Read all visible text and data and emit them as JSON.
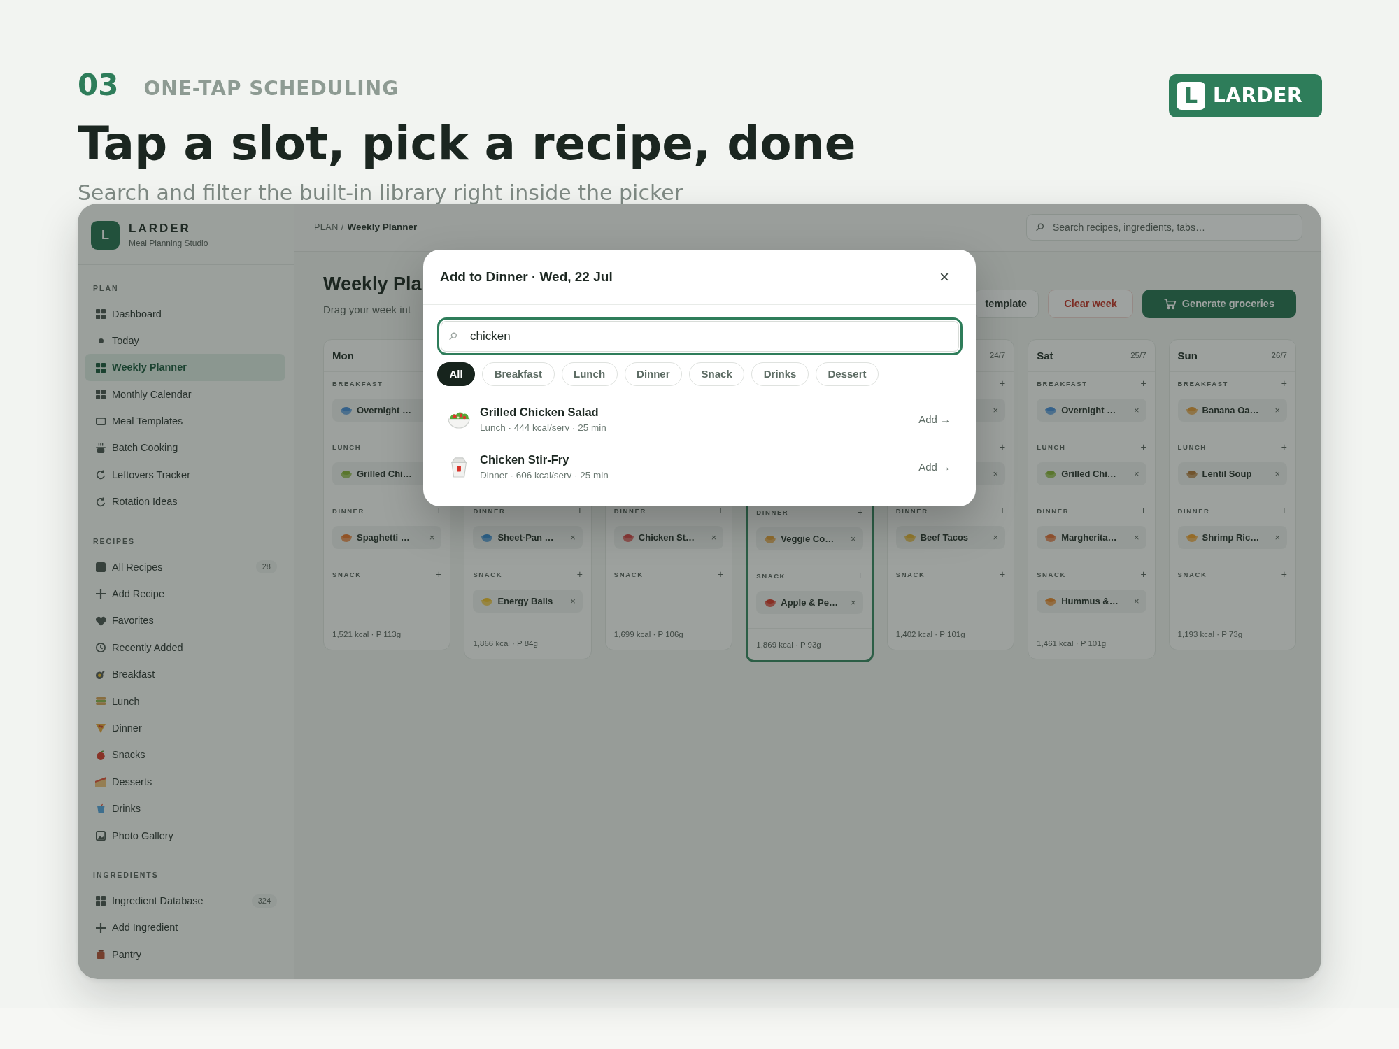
{
  "slide": {
    "number": "03",
    "kicker": "ONE-TAP SCHEDULING",
    "title": "Tap a slot, pick a recipe, done",
    "subtitle": "Search and filter the built-in library right inside the picker",
    "logo": {
      "mark": "L",
      "name": "LARDER"
    }
  },
  "app": {
    "sidebar": {
      "brand": {
        "mark": "L",
        "name": "LARDER",
        "tagline": "Meal Planning Studio"
      },
      "sections": [
        {
          "label": "PLAN",
          "items": [
            {
              "label": "Dashboard",
              "selected": false
            },
            {
              "label": "Today",
              "selected": false
            },
            {
              "label": "Weekly Planner",
              "selected": true
            },
            {
              "label": "Monthly Calendar",
              "selected": false
            },
            {
              "label": "Meal Templates",
              "selected": false
            },
            {
              "label": "Batch Cooking",
              "selected": false
            },
            {
              "label": "Leftovers Tracker",
              "selected": false
            },
            {
              "label": "Rotation Ideas",
              "selected": false
            }
          ]
        },
        {
          "label": "RECIPES",
          "items": [
            {
              "label": "All Recipes",
              "selected": false,
              "count": "28"
            },
            {
              "label": "Add Recipe",
              "selected": false
            },
            {
              "label": "Favorites",
              "selected": false
            },
            {
              "label": "Recently Added",
              "selected": false
            },
            {
              "label": "Breakfast",
              "selected": false
            },
            {
              "label": "Lunch",
              "selected": false
            },
            {
              "label": "Dinner",
              "selected": false
            },
            {
              "label": "Snacks",
              "selected": false
            },
            {
              "label": "Desserts",
              "selected": false
            },
            {
              "label": "Drinks",
              "selected": false
            },
            {
              "label": "Photo Gallery",
              "selected": false
            }
          ]
        },
        {
          "label": "INGREDIENTS",
          "items": [
            {
              "label": "Ingredient Database",
              "selected": false,
              "count": "324"
            },
            {
              "label": "Add Ingredient",
              "selected": false
            },
            {
              "label": "Pantry",
              "selected": false
            }
          ]
        }
      ]
    },
    "topbar": {
      "breadcrumb": {
        "section": "PLAN /",
        "current": "Weekly Planner"
      },
      "search": {
        "placeholder": "Search recipes, ingredients, tabs…"
      }
    },
    "header": {
      "title": "Weekly Pla",
      "subtitle": "Drag your week int",
      "actions": [
        {
          "label": "template",
          "kind": "outline"
        },
        {
          "label": "Clear week",
          "kind": "danger"
        },
        {
          "label": "Generate groceries",
          "kind": "primary"
        }
      ]
    },
    "board": {
      "days": [
        {
          "name": "Mon",
          "today": false,
          "breakfast": {
            "label": "BREAKFAST",
            "meal": {
              "name": "Overnight …"
            }
          },
          "lunch": {
            "label": "LUNCH",
            "meal": {
              "name": "Grilled Chi…"
            }
          },
          "dinner": {
            "label": "DINNER",
            "add": "+",
            "meal": {
              "name": "Spaghetti …",
              "remove": "×"
            }
          },
          "snack": {
            "label": "SNACK",
            "add": "+"
          },
          "totals": "1,521 kcal · P 113g"
        },
        {
          "today": false,
          "dinner": {
            "label": "DINNER",
            "add": "+",
            "meal": {
              "name": "Sheet-Pan …",
              "remove": "×"
            }
          },
          "snack": {
            "label": "SNACK",
            "add": "+",
            "meal": {
              "name": "Energy Balls",
              "remove": "×"
            }
          },
          "totals": "1,866 kcal · P 84g"
        },
        {
          "today": false,
          "dinner": {
            "label": "DINNER",
            "add": "+",
            "meal": {
              "name": "Chicken St…",
              "remove": "×"
            }
          },
          "snack": {
            "label": "SNACK",
            "add": "+"
          },
          "totals": "1,699 kcal · P 106g"
        },
        {
          "today": true,
          "dinner": {
            "label": "DINNER",
            "add": "+",
            "meal": {
              "name": "Veggie Co…",
              "remove": "×"
            }
          },
          "snack": {
            "label": "SNACK",
            "add": "+",
            "meal": {
              "name": "Apple & Pe…",
              "remove": "×"
            }
          },
          "totals": "1,869 kcal · P 93g"
        },
        {
          "date": "24/7",
          "today": false,
          "breakfast": {
            "add": "+",
            "meal": {
              "remove": "×"
            }
          },
          "lunch": {
            "add": "+",
            "meal": {
              "remove": "×"
            }
          },
          "dinner": {
            "label": "DINNER",
            "add": "+",
            "meal": {
              "name": "Beef Tacos",
              "remove": "×"
            }
          },
          "snack": {
            "label": "SNACK",
            "add": "+"
          },
          "totals": "1,402 kcal · P 101g"
        },
        {
          "name": "Sat",
          "date": "25/7",
          "today": false,
          "breakfast": {
            "label": "BREAKFAST",
            "add": "+",
            "meal": {
              "name": "Overnight …",
              "remove": "×"
            }
          },
          "lunch": {
            "label": "LUNCH",
            "add": "+",
            "meal": {
              "name": "Grilled Chi…",
              "remove": "×"
            }
          },
          "dinner": {
            "label": "DINNER",
            "add": "+",
            "meal": {
              "name": "Margherita…",
              "remove": "×"
            }
          },
          "snack": {
            "label": "SNACK",
            "add": "+",
            "meal": {
              "name": "Hummus &…",
              "remove": "×"
            }
          },
          "totals": "1,461 kcal · P 101g"
        },
        {
          "name": "Sun",
          "date": "26/7",
          "today": false,
          "breakfast": {
            "label": "BREAKFAST",
            "add": "+",
            "meal": {
              "name": "Banana Oa…",
              "remove": "×"
            }
          },
          "lunch": {
            "label": "LUNCH",
            "add": "+",
            "meal": {
              "name": "Lentil Soup",
              "remove": "×"
            }
          },
          "dinner": {
            "label": "DINNER",
            "add": "+",
            "meal": {
              "name": "Shrimp Ric…",
              "remove": "×"
            }
          },
          "snack": {
            "label": "SNACK",
            "add": "+"
          },
          "totals": "1,193 kcal · P 73g"
        }
      ]
    },
    "modal": {
      "title": "Add to Dinner · Wed, 22 Jul",
      "close": "×",
      "search": {
        "value": "chicken"
      },
      "filters": [
        {
          "label": "All",
          "selected": true
        },
        {
          "label": "Breakfast",
          "selected": false
        },
        {
          "label": "Lunch",
          "selected": false
        },
        {
          "label": "Dinner",
          "selected": false
        },
        {
          "label": "Snack",
          "selected": false
        },
        {
          "label": "Drinks",
          "selected": false
        },
        {
          "label": "Dessert",
          "selected": false
        }
      ],
      "results": [
        {
          "title": "Grilled Chicken Salad",
          "meta": "Lunch · 444 kcal/serv · 25 min",
          "action": "Add →"
        },
        {
          "title": "Chicken Stir-Fry",
          "meta": "Dinner · 606 kcal/serv · 25 min",
          "action": "Add →"
        }
      ]
    }
  }
}
